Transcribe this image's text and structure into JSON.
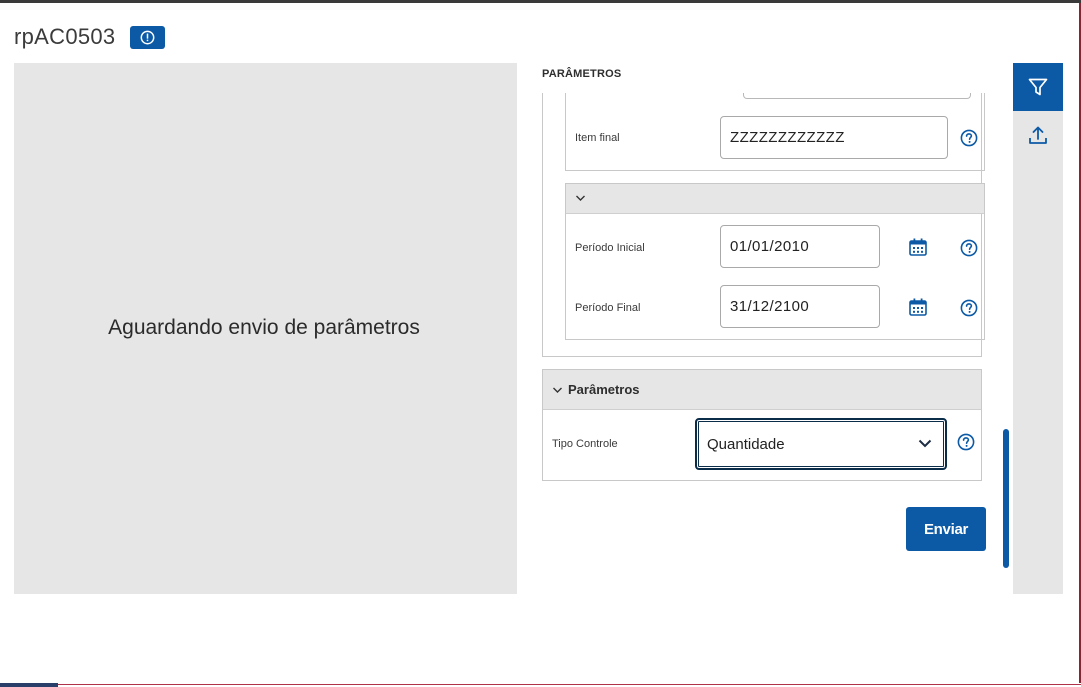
{
  "app": {
    "title": "rpAC0503",
    "info_icon": "info-circle-icon"
  },
  "preview": {
    "message": "Aguardando envio de parâmetros"
  },
  "form": {
    "section_header": "PARÂMETROS",
    "item_final": {
      "label": "Item final",
      "value": "ZZZZZZZZZZZZ"
    },
    "periodo_inicial": {
      "label": "Período Inicial",
      "value": "01/01/2010"
    },
    "periodo_final": {
      "label": "Período Final",
      "value": "31/12/2100"
    },
    "parametros_group": {
      "title": "Parâmetros",
      "tipo_controle": {
        "label": "Tipo Controle",
        "selected": "Quantidade"
      }
    },
    "submit_label": "Enviar"
  },
  "side_rail": {
    "items": [
      {
        "icon": "filter-icon",
        "active": true
      },
      {
        "icon": "upload-icon",
        "active": false
      }
    ]
  },
  "colors": {
    "primary": "#0c5aa6",
    "panel_gray": "#e6e6e6",
    "select_border": "#0b2d4a"
  }
}
